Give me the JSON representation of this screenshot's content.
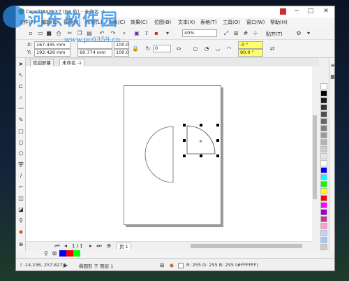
{
  "window": {
    "title": "CorelDRAW X7 (64 位) - 未命名 -1",
    "controls": [
      "minimize-icon",
      "maximize-icon",
      "close-icon"
    ]
  },
  "menubar": [
    "文件(F)",
    "编辑(E)",
    "视图(V)",
    "布局(L)",
    "对象(C)",
    "效果(C)",
    "位图(B)",
    "文本(X)",
    "表格(T)",
    "工具(O)",
    "窗口(W)",
    "帮助(H)"
  ],
  "toolbar": {
    "zoom": "40%",
    "snap_label": "贴齐(T)"
  },
  "propertybar": {
    "x": "167.435 mm",
    "y": "192.429 mm",
    "width": "",
    "height": "60.774 mm",
    "scale_w": "100.0",
    "scale_h": "100.0",
    "angle": "0",
    "start_angle": ".0 °",
    "end_angle": "90.0 °"
  },
  "tabs": [
    "欢迎屏幕",
    "未命名 -1"
  ],
  "page_nav": {
    "counter": "1 / 1",
    "page_tab": "页 1"
  },
  "palette_colors": [
    "#ffffff",
    "#000000",
    "#1a1a1a",
    "#333333",
    "#4d4d4d",
    "#666666",
    "#808080",
    "#999999",
    "#b3b3b3",
    "#cccccc",
    "#e6e6e6",
    "#ffffff",
    "#0000ff",
    "#00ffff",
    "#00ff00",
    "#ffff00",
    "#ff0000",
    "#ff00ff",
    "#9900cc",
    "#cc3399",
    "#ff99cc",
    "#ccccff",
    "#99ccff",
    "#cccccc"
  ],
  "doc_palette": [
    "#0000ff",
    "#ff0000",
    "#00ff00"
  ],
  "status": {
    "coords": "( -14.236, 257.827 )",
    "object_info": "椭圆形 于 图层 1",
    "fill_info": "R: 255 G: 255 B: 255 (#FFFFFF)"
  },
  "watermark": {
    "title": "河东软件园",
    "url": "www.pc0359.cn"
  }
}
